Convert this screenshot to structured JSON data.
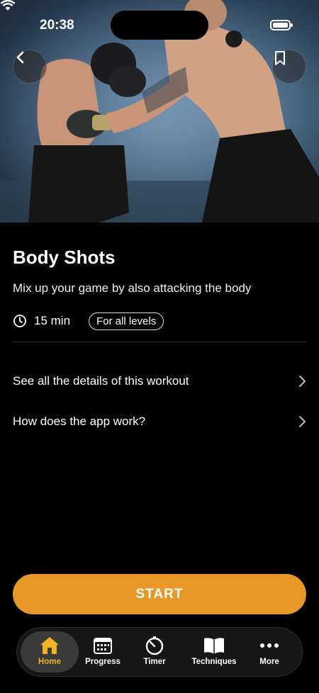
{
  "status_bar": {
    "time": "20:38"
  },
  "hero": {
    "alt": "Two boxers sparring in a gym"
  },
  "workout": {
    "title": "Body Shots",
    "description": "Mix up your game by also attacking the body",
    "duration": "15 min",
    "level": "For all levels"
  },
  "links": [
    {
      "label": "See all the details of this workout"
    },
    {
      "label": "How does the app work?"
    }
  ],
  "start_button": {
    "label": "START"
  },
  "tab_bar": {
    "items": [
      {
        "label": "Home",
        "icon": "home-icon",
        "active": true
      },
      {
        "label": "Progress",
        "icon": "calendar-icon",
        "active": false
      },
      {
        "label": "Timer",
        "icon": "timer-icon",
        "active": false
      },
      {
        "label": "Techniques",
        "icon": "book-icon",
        "active": false
      },
      {
        "label": "More",
        "icon": "more-icon",
        "active": false
      }
    ]
  },
  "colors": {
    "accent": "#e89826",
    "active_tab": "#f2b321",
    "background": "#000000"
  }
}
